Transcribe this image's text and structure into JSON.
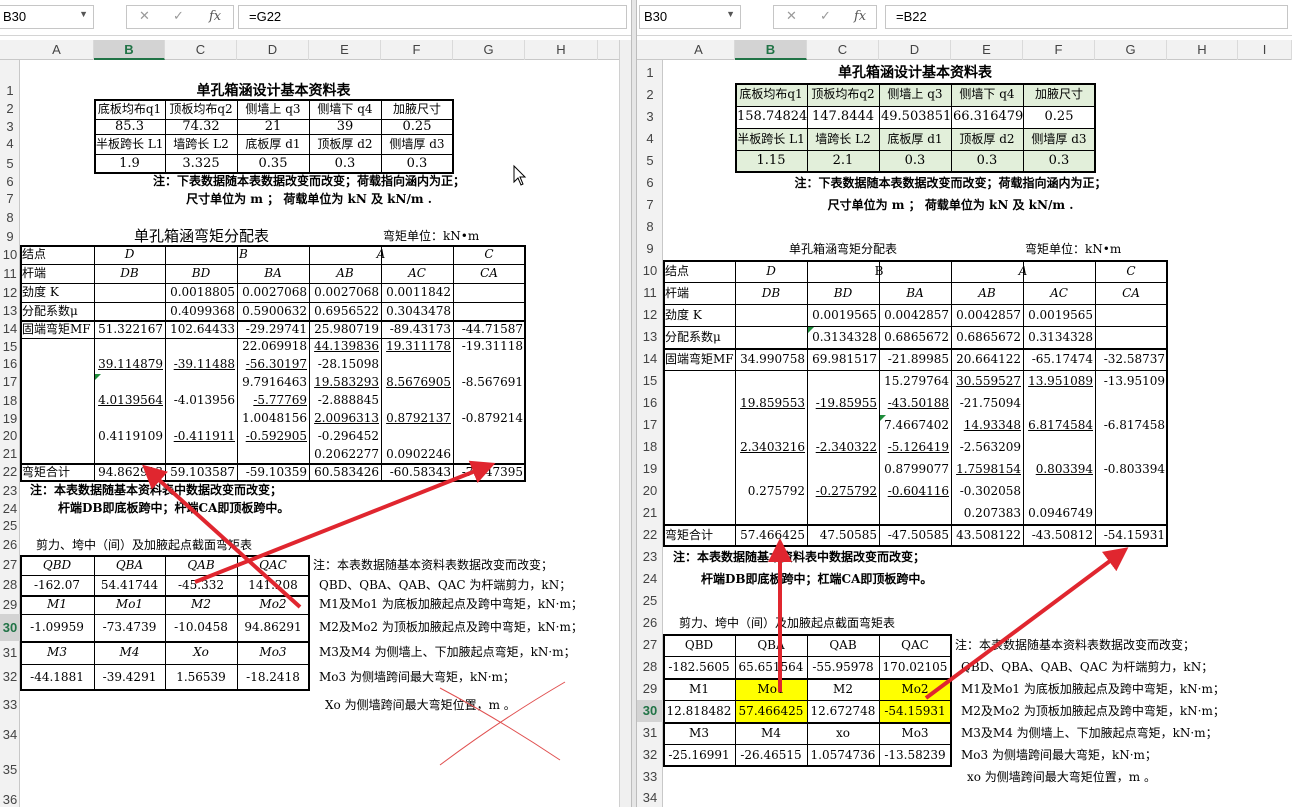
{
  "left": {
    "name_box": "B30",
    "formula": "=G22",
    "col_headers": [
      "A",
      "B",
      "C",
      "D",
      "E",
      "F",
      "G",
      "H"
    ],
    "rows": [
      "1",
      "2",
      "3",
      "4",
      "5",
      "6",
      "7",
      "8",
      "9",
      "10",
      "11",
      "12",
      "13",
      "14",
      "15",
      "16",
      "17",
      "18",
      "19",
      "20",
      "21",
      "22",
      "23",
      "24",
      "25",
      "26",
      "27",
      "28",
      "29",
      "30",
      "31",
      "32",
      "33",
      "34",
      "35",
      "36"
    ],
    "title1": "单孔箱涵设计基本资料表",
    "load_hdr": [
      "底板均布q1",
      "顶板均布q2",
      "侧墙上 q3",
      "侧墙下 q4",
      "加腋尺寸"
    ],
    "load_val": [
      "85.3",
      "74.32",
      "21",
      "39",
      "0.25"
    ],
    "dim_hdr": [
      "半板跨长 L1",
      "墙跨长 L2",
      "底板厚 d1",
      "顶板厚 d2",
      "侧墙厚 d3"
    ],
    "dim_val": [
      "1.9",
      "3.325",
      "0.35",
      "0.3",
      "0.3"
    ],
    "note1": "注：下表数据随本表数据改变而改变；荷载指向涵内为正；",
    "note2": "尺寸单位为 m ； 荷载单位为 kN 及 kN/m .",
    "title2": "单孔箱涵弯矩分配表",
    "unit": "弯矩单位：kN•m",
    "r10": [
      "结点",
      "D",
      "B",
      "A",
      "C"
    ],
    "r11": [
      "杆端",
      "DB",
      "BD",
      "BA",
      "AB",
      "AC",
      "CA"
    ],
    "r12": [
      "劲度 K",
      "",
      "0.0018805",
      "0.0027068",
      "0.0027068",
      "0.0011842",
      ""
    ],
    "r13": [
      "分配系数μ",
      "",
      "0.4099368",
      "0.5900632",
      "0.6956522",
      "0.3043478",
      ""
    ],
    "r14": [
      "固端弯矩MF",
      "51.322167",
      "102.64433",
      "-29.29741",
      "25.980719",
      "-89.43173",
      "-44.71587"
    ],
    "r15": [
      "",
      "",
      "",
      "22.069918",
      "44.139836",
      "19.311178",
      "-19.31118"
    ],
    "r16": [
      "",
      "39.114879",
      "-39.11488",
      "-56.30197",
      "-28.15098",
      "",
      ""
    ],
    "r17": [
      "",
      "",
      "",
      "9.7916463",
      "19.583293",
      "8.5676905",
      "-8.567691"
    ],
    "r18": [
      "",
      "4.0139564",
      "-4.013956",
      "-5.77769",
      "-2.888845",
      "",
      ""
    ],
    "r19": [
      "",
      "",
      "",
      "1.0048156",
      "2.0096313",
      "0.8792137",
      "-0.879214"
    ],
    "r20": [
      "",
      "0.4119109",
      "-0.411911",
      "-0.592905",
      "-0.296452",
      "",
      ""
    ],
    "r21": [
      "",
      "",
      "",
      "",
      "0.2062277",
      "0.0902246",
      ""
    ],
    "r22": [
      "弯矩合计",
      "94.862913",
      "59.103587",
      "-59.10359",
      "60.583426",
      "-60.58343",
      "-73.47395"
    ],
    "note3": "注：本表数据随基本资料表中数据改变而改变；",
    "note4": "杆端DB即底板跨中；杆端CA即顶板跨中。",
    "title3": "剪力、垮中（间）及加腋起点截面弯矩表",
    "s27": [
      "QBD",
      "QBA",
      "QAB",
      "QAC"
    ],
    "s28": [
      "-162.07",
      "54.41744",
      "-45.332",
      "141.208"
    ],
    "s29": [
      "M1",
      "Mo1",
      "M2",
      "Mo2"
    ],
    "s30": [
      "-1.09959",
      "-73.4739",
      "-10.0458",
      "94.86291"
    ],
    "s31": [
      "M3",
      "M4",
      "Xo",
      "Mo3"
    ],
    "s32": [
      "-44.1881",
      "-39.4291",
      "1.56539",
      "-18.2418"
    ],
    "explain": [
      "注：本表数据随基本资料表数据改变而改变；",
      "QBD、QBA、QAB、QAC 为杆端剪力，kN；",
      "M1及Mo1 为底板加腋起点及跨中弯矩，kN·m；",
      "M2及Mo2 为顶板加腋起点及跨中弯矩，kN·m；",
      "M3及M4 为侧墙上、下加腋起点弯矩，kN·m；",
      "Mo3 为侧墙跨间最大弯矩，kN·m；",
      "Xo 为侧墙跨间最大弯矩位置，m 。"
    ]
  },
  "right": {
    "name_box": "B30",
    "formula": "=B22",
    "col_headers": [
      "A",
      "B",
      "C",
      "D",
      "E",
      "F",
      "G",
      "H",
      "I"
    ],
    "rows": [
      "1",
      "2",
      "3",
      "4",
      "5",
      "6",
      "7",
      "8",
      "9",
      "10",
      "11",
      "12",
      "13",
      "14",
      "15",
      "16",
      "17",
      "18",
      "19",
      "20",
      "21",
      "22",
      "23",
      "24",
      "25",
      "26",
      "27",
      "28",
      "29",
      "30",
      "31",
      "32",
      "33",
      "34"
    ],
    "title1": "单孔箱涵设计基本资料表",
    "load_hdr": [
      "底板均布q1",
      "顶板均布q2",
      "侧墙上 q3",
      "侧墙下 q4",
      "加腋尺寸"
    ],
    "load_val": [
      "158.74824",
      "147.8444",
      "49.503851",
      "66.316479",
      "0.25"
    ],
    "dim_hdr": [
      "半板跨长 L1",
      "墙跨长 L2",
      "底板厚 d1",
      "顶板厚 d2",
      "侧墙厚 d3"
    ],
    "dim_val": [
      "1.15",
      "2.1",
      "0.3",
      "0.3",
      "0.3"
    ],
    "note1": "注：下表数据随本表数据改变而改变；荷载指向涵内为正；",
    "note2": "尺寸单位为 m ； 荷载单位为 kN 及 kN/m .",
    "title2": "单孔箱涵弯矩分配表",
    "unit": "弯矩单位：kN•m",
    "r10": [
      "结点",
      "D",
      "B",
      "A",
      "C"
    ],
    "r11": [
      "杆端",
      "DB",
      "BD",
      "BA",
      "AB",
      "AC",
      "CA"
    ],
    "r12": [
      "劲度 K",
      "",
      "0.0019565",
      "0.0042857",
      "0.0042857",
      "0.0019565",
      ""
    ],
    "r13": [
      "分配系数μ",
      "",
      "0.3134328",
      "0.6865672",
      "0.6865672",
      "0.3134328",
      ""
    ],
    "r14": [
      "固端弯矩MF",
      "34.990758",
      "69.981517",
      "-21.89985",
      "20.664122",
      "-65.17474",
      "-32.58737"
    ],
    "r15": [
      "",
      "",
      "",
      "15.279764",
      "30.559527",
      "13.951089",
      "-13.95109"
    ],
    "r16": [
      "",
      "19.859553",
      "-19.85955",
      "-43.50188",
      "-21.75094",
      "",
      ""
    ],
    "r17": [
      "",
      "",
      "",
      "7.4667402",
      "14.93348",
      "6.8174584",
      "-6.817458"
    ],
    "r18": [
      "",
      "2.3403216",
      "-2.340322",
      "-5.126419",
      "-2.563209",
      "",
      ""
    ],
    "r19": [
      "",
      "",
      "",
      "0.8799077",
      "1.7598154",
      "0.803394",
      "-0.803394"
    ],
    "r20": [
      "",
      "0.275792",
      "-0.275792",
      "-0.604116",
      "-0.302058",
      "",
      ""
    ],
    "r21": [
      "",
      "",
      "",
      "",
      "0.207383",
      "0.0946749",
      ""
    ],
    "r22": [
      "弯矩合计",
      "57.466425",
      "47.50585",
      "-47.50585",
      "43.508122",
      "-43.50812",
      "-54.15931"
    ],
    "note3": "注：本表数据随基本资料表中数据改变而改变；",
    "note4": "杆端DB即底板跨中；杠端CA即顶板跨中。",
    "title3": "剪力、垮中（间）及加腋起点截面弯矩表",
    "s27": [
      "QBD",
      "QBA",
      "QAB",
      "QAC"
    ],
    "s28": [
      "-182.5605",
      "65.651564",
      "-55.95978",
      "170.02105"
    ],
    "s29": [
      "M1",
      "Mo1",
      "M2",
      "Mo2"
    ],
    "s30": [
      "12.818482",
      "57.466425",
      "12.672748",
      "-54.15931"
    ],
    "s31": [
      "M3",
      "M4",
      "xo",
      "Mo3"
    ],
    "s32": [
      "-25.16991",
      "-26.46515",
      "1.0574736",
      "-13.58239"
    ],
    "explain": [
      "注：本表数据随基本资料表数据改变而改变；",
      "QBD、QBA、QAB、QAC 为杆端剪力，kN；",
      "M1及Mo1 为底板加腋起点及跨中弯矩，kN·m；",
      "M2及Mo2 为顶板加腋起点及跨中弯矩，kN·m；",
      "M3及M4 为侧墙上、下加腋起点弯矩，kN·m；",
      "Mo3 为侧墙跨间最大弯矩，kN·m；",
      "xo 为侧墙跨间最大弯矩位置，m 。"
    ]
  },
  "colors": {
    "arrow": "#e0262f",
    "highlight": "#ffff00",
    "green": "#e2efda",
    "selected": "#217346"
  },
  "icons": [
    "cancel-icon",
    "enter-icon",
    "function-icon",
    "cursor-icon"
  ]
}
